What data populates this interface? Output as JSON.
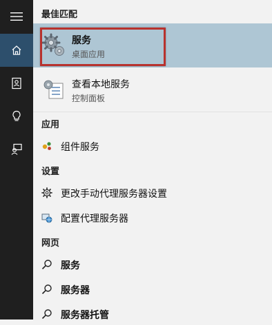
{
  "sections": {
    "best_match": "最佳匹配",
    "apps": "应用",
    "settings": "设置",
    "web": "网页"
  },
  "best_match_item": {
    "title": "服务",
    "subtitle": "桌面应用",
    "icon": "services-gear-icon"
  },
  "second_item": {
    "title": "查看本地服务",
    "subtitle": "控制面板",
    "icon": "control-panel-services-icon"
  },
  "apps": [
    {
      "label": "组件服务",
      "icon": "component-services-icon"
    }
  ],
  "settings": [
    {
      "label": "更改手动代理服务器设置",
      "icon": "gear-icon"
    },
    {
      "label": "配置代理服务器",
      "icon": "network-globe-icon"
    }
  ],
  "web": [
    {
      "label": "服务",
      "icon": "search-icon"
    },
    {
      "label": "服务器",
      "icon": "search-icon"
    },
    {
      "label": "服务器托管",
      "icon": "search-icon"
    }
  ],
  "rail": [
    "hamburger-menu-icon",
    "home-icon",
    "notebook-icon",
    "lightbulb-icon",
    "feedback-icon"
  ],
  "colors": {
    "rail_bg": "#1f1f1f",
    "rail_active": "#2d4f6c",
    "selected_bg": "#aec6d4",
    "highlight_border": "#b8322e"
  }
}
